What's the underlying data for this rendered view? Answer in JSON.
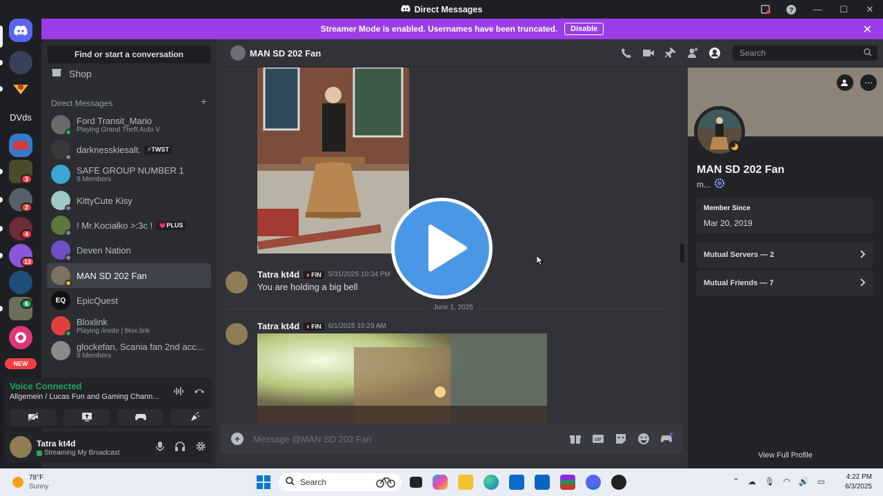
{
  "window": {
    "title": "Direct Messages"
  },
  "banner": {
    "text": "Streamer Mode is enabled. Usernames have been truncated.",
    "disable_label": "Disable"
  },
  "rail": {
    "folder_label": "DVds",
    "new_badge": "NEW",
    "badges": [
      "3",
      "2",
      "4",
      "13",
      "6"
    ]
  },
  "sidebar": {
    "find_label": "Find or start a conversation",
    "shop_label": "Shop",
    "dm_header": "Direct Messages",
    "items": [
      {
        "name": "Ford Transit_Mario",
        "sub": "Playing Grand Theft Auto V",
        "status": "#23a55a",
        "color": "#6b6b6b"
      },
      {
        "name": "darknesskiesalt.",
        "tag": "⚡TWST",
        "status": "#80848e",
        "color": "#3a3a3a"
      },
      {
        "name": "SAFE GROUP NUMBER 1",
        "sub": "8 Members",
        "status": "",
        "color": "#3ba5d6"
      },
      {
        "name": "KittyCute Kisy",
        "status": "#80848e",
        "color": "#9fc9c9"
      },
      {
        "name": "! Mr.Kociałko >:3c !",
        "tag": "💗PLUS",
        "status": "#80848e",
        "color": "#5b7a3a"
      },
      {
        "name": "Deven Nation",
        "status": "#80848e",
        "color": "#6e4fc6"
      },
      {
        "name": "MAN SD 202 Fan",
        "status": "#f0b232",
        "color": "#7b7261"
      },
      {
        "name": "EpicQuest",
        "status": "",
        "color": "#111111",
        "initials": "EQ"
      },
      {
        "name": "Bloxlink",
        "sub": "Playing /invite | blox.link",
        "status": "#23a55a",
        "color": "#e0413e"
      },
      {
        "name": "glockefan, Scania fan 2nd acc...",
        "sub": "8 Members",
        "status": "",
        "color": "#8a8a8a"
      }
    ]
  },
  "voice": {
    "status": "Voice Connected",
    "channel": "Allgemein / Lucas Fun and Gaming Chann..."
  },
  "user": {
    "name": "Tatra kt4d",
    "status": "Streaming My Broadcast"
  },
  "chat": {
    "recipient": "MAN SD 202 Fan",
    "search_placeholder": "Search",
    "messages": [
      {
        "author": "Tatra kt4d",
        "tag": "FIN",
        "time": "5/31/2025 10:34 PM",
        "text": "You are holding a big bell"
      },
      {
        "author": "Tatra kt4d",
        "tag": "FIN",
        "time": "6/1/2025 10:29 AM",
        "text": ""
      }
    ],
    "date_divider": "June 1, 2025",
    "composer_placeholder": "Message @MAN SD 202 Fan"
  },
  "profile": {
    "name": "MAN SD 202 Fan",
    "sub": "m...",
    "member_since_label": "Member Since",
    "member_since": "Mar 20, 2019",
    "mutual_servers": "Mutual Servers — 2",
    "mutual_friends": "Mutual Friends — 7",
    "view_full": "View Full Profile"
  },
  "taskbar": {
    "temp": "78°F",
    "weather": "Sunny",
    "search": "Search",
    "time": "4:22 PM",
    "date": "6/3/2025"
  }
}
